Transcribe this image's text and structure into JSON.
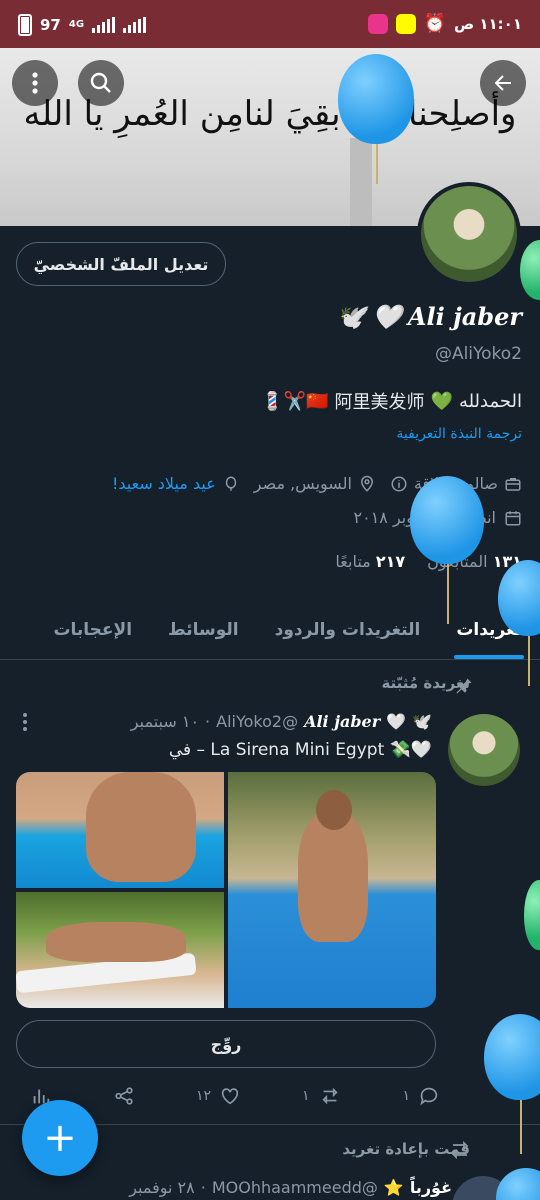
{
  "status_bar": {
    "time": "١١:٠١ ص",
    "battery": "97",
    "network": "4G"
  },
  "banner": {
    "text": "وأصلِحنا فيمابقِيَ لنامِن العُمرِ يا الله"
  },
  "profile": {
    "edit_button": "تعديل الملفّ الشخصيّ",
    "display_name": "Ali jaber",
    "name_emoji_heart": "🤍",
    "name_emoji_dove": "🕊️",
    "handle": "@AliYoko2",
    "bio_text": "الحمدلله",
    "bio_heart": "💚",
    "bio_chinese": "阿里美发师",
    "bio_emojis": "🇨🇳✂️💈",
    "translate_bio": "ترجمة النبذة التعريفية",
    "category": "صالون حلاقة",
    "location": "السويس, مصر",
    "birthday": "عيد ميلاد سعيد!",
    "joined": "انضم في أكتوبر ٢٠١٨",
    "following_count": "٢١٧",
    "following_label": "متابعًا",
    "followers_count": "١٣١",
    "followers_label": "المتابعون"
  },
  "tabs": [
    {
      "label": "تغريدات",
      "active": true
    },
    {
      "label": "التغريدات والردود",
      "active": false
    },
    {
      "label": "الوسائط",
      "active": false
    },
    {
      "label": "الإعجابات",
      "active": false
    }
  ],
  "pinned": {
    "label": "تغريدة مُثبّتة",
    "author_name": "Ali jaber",
    "author_handle": "@AliYoko2",
    "date": "١٠ سبتمبر",
    "location_text": "La Sirena Mini Egypt – في",
    "emojis": "🤍💸",
    "translate_button": "روِّج",
    "replies": "١",
    "retweets": "١",
    "likes": "١٢"
  },
  "retweet_item": {
    "label": "قمت بإعادة تغريد",
    "author_name": "غوُرباً",
    "star": "⭐",
    "author_handle": "@MOOhhaammeedd",
    "date": "٢٨ نوفمبر"
  },
  "fab": {
    "label": "+"
  },
  "colors": {
    "background": "#15202b",
    "accent": "#1d9bf0",
    "status_bar": "#7a2c34",
    "muted": "#8b98a5"
  }
}
